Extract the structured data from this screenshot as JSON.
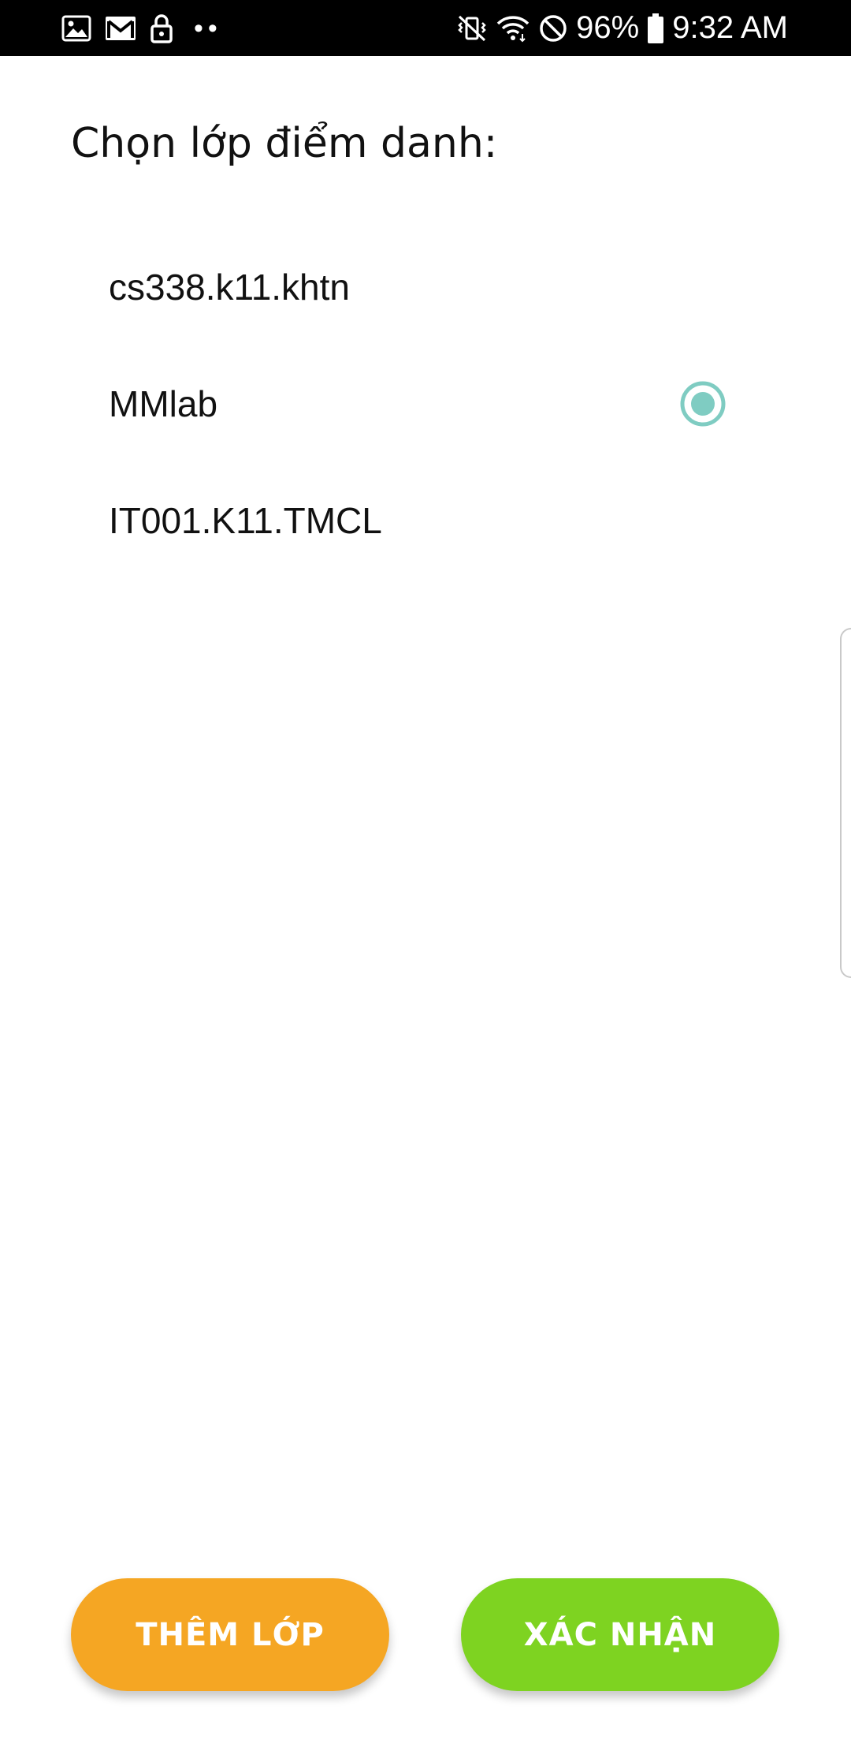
{
  "status_bar": {
    "battery_percent": "96%",
    "time": "9:32 AM",
    "left_icons": [
      "gallery-icon",
      "gmail-icon",
      "lock-icon"
    ],
    "right_icons": [
      "mute-vibrate-icon",
      "wifi-icon",
      "do-not-disturb-icon",
      "battery-icon"
    ]
  },
  "page": {
    "title": "Chọn lớp điểm danh:"
  },
  "options": [
    {
      "label": "cs338.k11.khtn",
      "selected": false
    },
    {
      "label": "MMlab",
      "selected": true
    },
    {
      "label": "IT001.K11.TMCL",
      "selected": false
    }
  ],
  "colors": {
    "radio_accent": "#7FCCC2",
    "add_button": "#F5A623",
    "confirm_button": "#7ED321"
  },
  "buttons": {
    "add_label": "THÊM LỚP",
    "confirm_label": "XÁC NHẬN"
  }
}
